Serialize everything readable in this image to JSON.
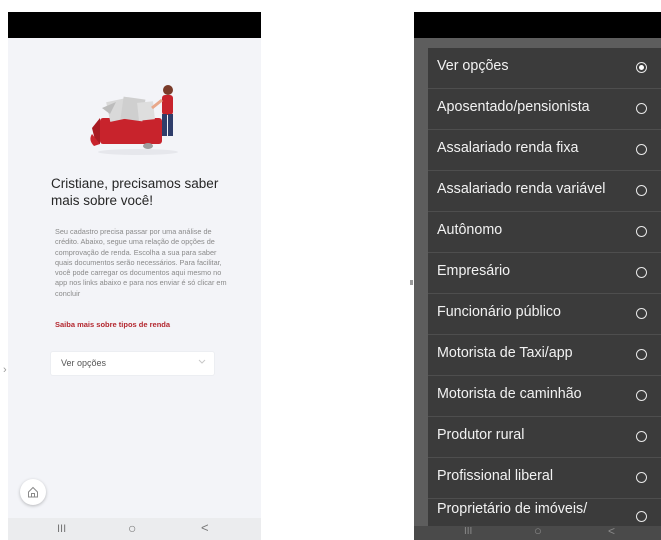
{
  "left_screen": {
    "title": "Cristiane, precisamos saber mais sobre você!",
    "description": "Seu cadastro precisa passar por uma análise de crédito. Abaixo, segue uma relação de opções de comprovação de renda. Escolha a sua para saber quais documentos serão necessários. Para facilitar, você pode carregar os documentos aqui mesmo no app nos links abaixo e para nos enviar é só clicar em concluir",
    "link": "Saiba mais sobre tipos de renda",
    "select_value": "Ver opções",
    "accent_color": "#b3262e",
    "icons": [
      "home-icon",
      "chevron-down-icon"
    ]
  },
  "nav": {
    "recents": "III",
    "home": "○",
    "back": "<"
  },
  "right_screen": {
    "options": [
      {
        "label": "Ver opções",
        "selected": true
      },
      {
        "label": "Aposentado/pensionista",
        "selected": false
      },
      {
        "label": "Assalariado renda fixa",
        "selected": false
      },
      {
        "label": "Assalariado renda variável",
        "selected": false
      },
      {
        "label": "Autônomo",
        "selected": false
      },
      {
        "label": "Empresário",
        "selected": false
      },
      {
        "label": "Funcionário público",
        "selected": false
      },
      {
        "label": "Motorista de Taxi/app",
        "selected": false
      },
      {
        "label": "Motorista de caminhão",
        "selected": false
      },
      {
        "label": "Produtor rural",
        "selected": false
      },
      {
        "label": "Profissional liberal",
        "selected": false
      },
      {
        "label": "Proprietário de imóveis/",
        "selected": false
      }
    ]
  }
}
